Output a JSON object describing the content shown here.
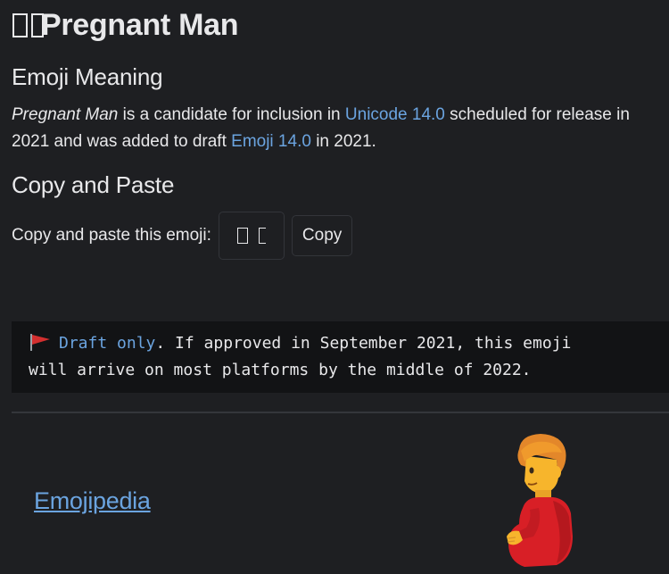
{
  "title": {
    "text": "Pregnant Man",
    "tofu_glyphs": "▯▯"
  },
  "meaning": {
    "heading": "Emoji Meaning",
    "emoji_name": "Pregnant Man",
    "text_part1": " is a candidate for inclusion in ",
    "unicode_link": "Unicode 14.0",
    "text_part2": " scheduled for release in",
    "text_part3": "2021 and was added to draft ",
    "emoji_link": "Emoji 14.0",
    "text_part4": " in 2021."
  },
  "copy_paste": {
    "heading": "Copy and Paste",
    "label": "Copy and paste this emoji:",
    "button_label": "Copy"
  },
  "draft_notice": {
    "flag_icon": "triangular-flag-icon",
    "link_text": "Draft only",
    "text_line1": ". If approved in September 2021, this emoji",
    "text_line2": "will arrive on most platforms by the middle of 2022."
  },
  "footer": {
    "brand": "Emojipedia"
  },
  "colors": {
    "background": "#1e1f22",
    "text": "#e8e8ea",
    "link": "#6ba4e0",
    "notice_bg": "#121315",
    "flag": "#d32f2f",
    "emoji_hair": "#e3872a",
    "emoji_skin": "#f7b52c",
    "emoji_shirt": "#d81f26"
  }
}
